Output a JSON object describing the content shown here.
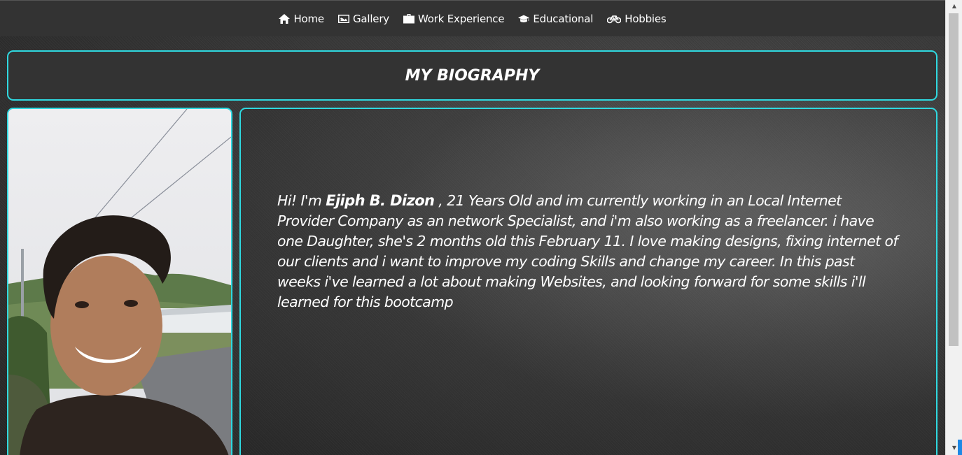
{
  "nav": {
    "items": [
      {
        "label": "Home",
        "icon": "home-icon"
      },
      {
        "label": "Gallery",
        "icon": "image-icon"
      },
      {
        "label": "Work Experience",
        "icon": "briefcase-icon"
      },
      {
        "label": "Educational",
        "icon": "graduation-cap-icon"
      },
      {
        "label": "Hobbies",
        "icon": "bicycle-icon"
      }
    ]
  },
  "header": {
    "title": "MY BIOGRAPHY"
  },
  "bio": {
    "intro": "Hi! I'm ",
    "name": "Ejiph B. Dizon",
    "body": " , 21 Years Old and im currently working in an Local Internet Provider Company as an network Specialist, and i'm also working as a freelancer. i have one Daughter, she's 2 months old this February 11. I love making designs, fixing internet of our clients and i want to improve my coding Skills and change my career. In this past weeks i've learned a lot about making Websites, and looking forward for some skills i'll learned for this bootcamp"
  },
  "colors": {
    "accent": "#2fd9e0",
    "navbar": "#333333",
    "text": "#ffffff"
  }
}
